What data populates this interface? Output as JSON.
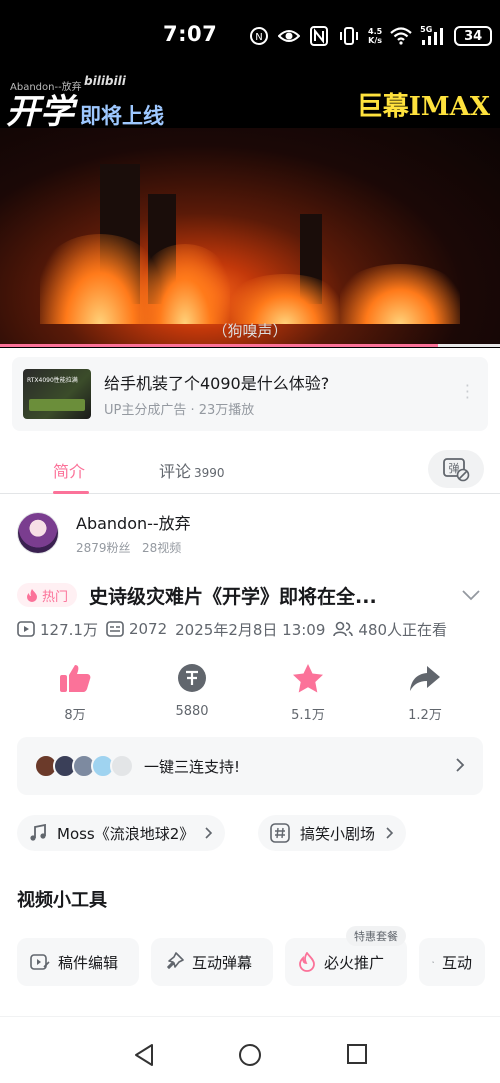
{
  "status_bar": {
    "time": "7:07",
    "net_speed_value": "4.5",
    "net_speed_unit": "K/s",
    "signal_label": "5G",
    "battery": "34",
    "icons": [
      "nfc-icon",
      "eye-icon",
      "n-icon",
      "vibrate-icon",
      "wifi-icon",
      "signal-icon",
      "battery-icon"
    ]
  },
  "video": {
    "uploader_tag": "Abandon--放弃",
    "logo_text": "bilibili",
    "title_big": "开学",
    "title_rest": "即将上线",
    "right_title": "巨幕IMAX",
    "subtitle": "（狗嗅声）",
    "progress": 0.876
  },
  "ad": {
    "thumb_text": "RTX4090性能拉满",
    "title": "给手机装了个4090是什么体验?",
    "subtitle": "UP主分成广告 · 23万播放"
  },
  "tabs": {
    "intro": "简介",
    "comments": "评论",
    "comments_count": "3990"
  },
  "uploader": {
    "name": "Abandon--放弃",
    "fans": "2879粉丝",
    "videos": "28视频"
  },
  "video_info": {
    "hot_badge": "热门",
    "title": "史诗级灾难片《开学》即将在全...",
    "plays": "127.1万",
    "danmaku": "2072",
    "date": "2025年2月8日 13:09",
    "watching": "480人正在看"
  },
  "actions": {
    "like": "8万",
    "coin": "5880",
    "favorite": "5.1万",
    "share": "1.2万"
  },
  "triple": {
    "text": "一键三连支持!"
  },
  "chips": {
    "music": "Moss《流浪地球2》",
    "topic": "搞笑小剧场"
  },
  "tools": {
    "section_title": "视频小工具",
    "edit": "稿件编辑",
    "interactive_danmaku": "互动弹幕",
    "promote": "必火推广",
    "promo_tag": "特惠套餐",
    "partial": "互动"
  },
  "colors": {
    "accent": "#fb7299",
    "text": "#18191c",
    "subtext": "#9499a0",
    "card_bg": "#f6f7f8"
  }
}
